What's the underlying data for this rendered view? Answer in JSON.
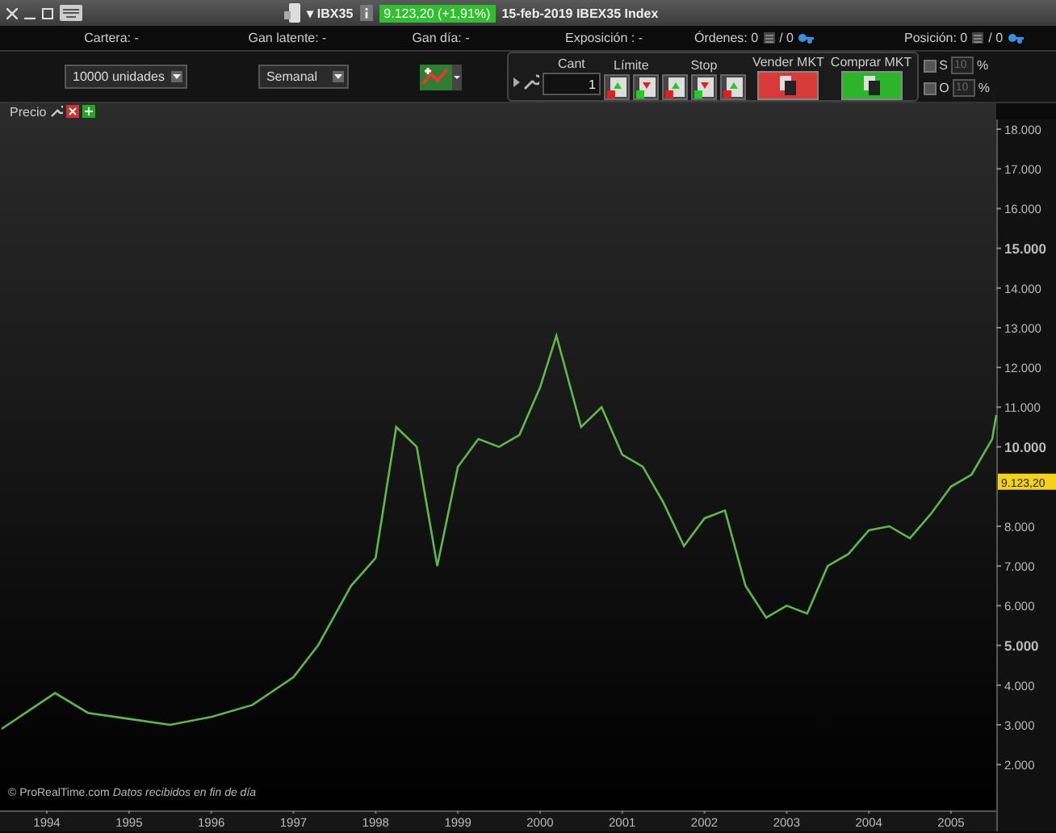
{
  "title_bar": {
    "symbol": "▾ IBX35",
    "price_badge": "9.123,20 (+1,91%)",
    "price_up": true,
    "instrument": "15-feb-2019 IBEX35 Index"
  },
  "info_bar": [
    {
      "kind": "plain",
      "text": "Cartera: -"
    },
    {
      "kind": "plain",
      "text": "Gan latente: -"
    },
    {
      "kind": "plain",
      "text": "Gan día: -"
    },
    {
      "kind": "plain",
      "text": "Exposición : -"
    },
    {
      "kind": "count",
      "text": "Órdenes: 0",
      "total": "/ 0"
    },
    {
      "kind": "count",
      "text": "Posición: 0",
      "total": "/ 0"
    }
  ],
  "toolbar": {
    "quantity_select": "10000 unidades",
    "period_select": "Semanal",
    "quantity_label": "Cant",
    "quantity_value": "1",
    "limit_label": "Límite",
    "stop_label": "Stop",
    "sell_label": "Vender MKT",
    "buy_label": "Comprar MKT",
    "options": [
      {
        "label": "S",
        "checked": false,
        "placeholder": "10",
        "unit": "%"
      },
      {
        "label": "O",
        "checked": false,
        "placeholder": "10",
        "unit": "%"
      }
    ]
  },
  "chart": {
    "label": "Precio",
    "price_label": "9.123,20",
    "footer": "© ProRealTime.com *Datos recibidos en fin de día*",
    "chart_data": {
      "type": "line",
      "xlim": [
        1993.43,
        2005.55
      ],
      "ylim": [
        846,
        18244
      ],
      "xticks": [
        {
          "value": 1994,
          "label": "1994"
        },
        {
          "value": 1995,
          "label": "1995"
        },
        {
          "value": 1996,
          "label": "1996"
        },
        {
          "value": 1997,
          "label": "1997"
        },
        {
          "value": 1998,
          "label": "1998"
        },
        {
          "value": 1999,
          "label": "1999"
        },
        {
          "value": 2000,
          "label": "2000"
        },
        {
          "value": 2001,
          "label": "2001"
        },
        {
          "value": 2002,
          "label": "2002"
        },
        {
          "value": 2003,
          "label": "2003"
        },
        {
          "value": 2004,
          "label": "2004"
        },
        {
          "value": 2005,
          "label": "2005"
        }
      ],
      "yticks": [
        {
          "value": 2000,
          "label": "2.000"
        },
        {
          "value": 3000,
          "label": "3.000"
        },
        {
          "value": 4000,
          "label": "4.000"
        },
        {
          "value": 5000,
          "label": "5.000"
        },
        {
          "value": 6000,
          "label": "6.000"
        },
        {
          "value": 7000,
          "label": "7.000"
        },
        {
          "value": 8000,
          "label": "8.000"
        },
        {
          "value": 10000,
          "label": "10.000"
        },
        {
          "value": 11000,
          "label": "11.000"
        },
        {
          "value": 12000,
          "label": "12.000"
        },
        {
          "value": 13000,
          "label": "13.000"
        },
        {
          "value": 14000,
          "label": "14.000"
        },
        {
          "value": 15000,
          "label": "15.000"
        },
        {
          "value": 16000,
          "label": "16.000"
        },
        {
          "value": 17000,
          "label": "17.000"
        },
        {
          "value": 18000,
          "label": "18.000"
        }
      ],
      "x": [
        1993.45,
        1994.1,
        1994.5,
        1995.0,
        1995.5,
        1996.0,
        1996.5,
        1997.0,
        1997.3,
        1997.7,
        1998.0,
        1998.25,
        1998.5,
        1998.75,
        1999.0,
        1999.25,
        1999.5,
        1999.75,
        2000.0,
        2000.2,
        2000.5,
        2000.75,
        2001.0,
        2001.25,
        2001.5,
        2001.75,
        2002.0,
        2002.25,
        2002.5,
        2002.75,
        2003.0,
        2003.25,
        2003.5,
        2003.75,
        2004.0,
        2004.25,
        2004.5,
        2004.75,
        2005.0,
        2005.25,
        2005.5,
        2005.55
      ],
      "series": [
        {
          "color": "#5fb84a",
          "values": [
            2900,
            3800,
            3300,
            3150,
            3000,
            3200,
            3500,
            4200,
            5000,
            6500,
            7200,
            10500,
            10000,
            7000,
            9500,
            10200,
            10000,
            10300,
            11500,
            12800,
            10500,
            11000,
            9800,
            9500,
            8600,
            7500,
            8200,
            8400,
            6500,
            5700,
            6000,
            5800,
            7000,
            7300,
            7900,
            8000,
            7700,
            8300,
            9000,
            9300,
            10200,
            10800
          ]
        }
      ]
    }
  }
}
